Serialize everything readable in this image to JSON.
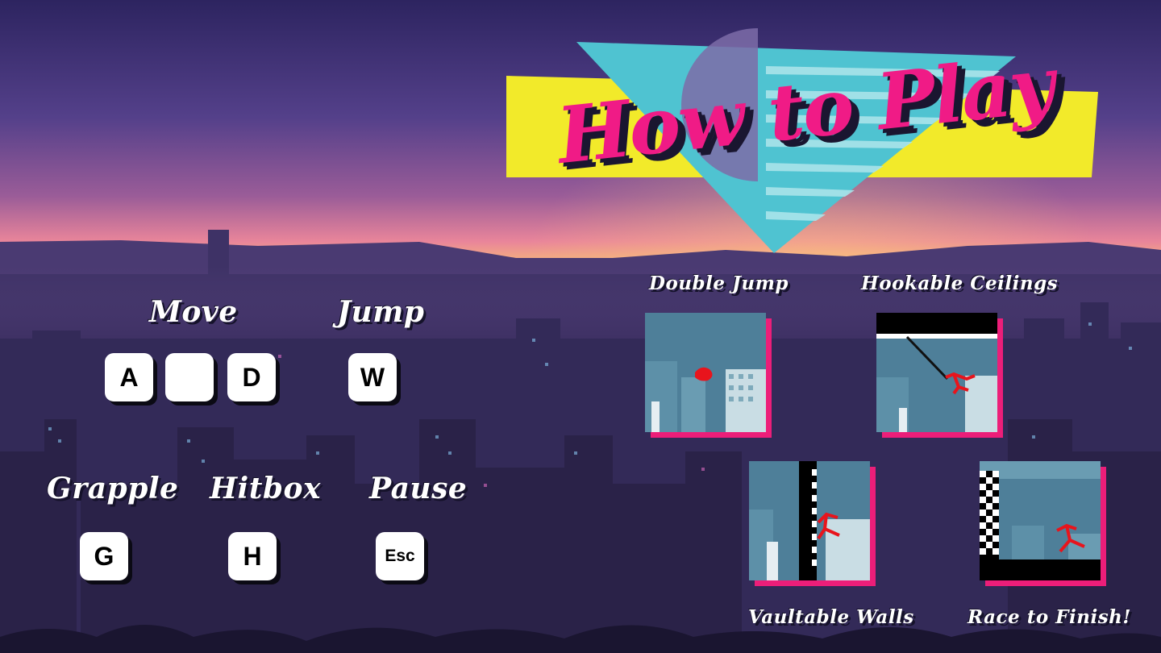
{
  "title": "How to Play",
  "controls": {
    "move": {
      "label": "Move",
      "keys": [
        "A",
        "",
        "D"
      ]
    },
    "jump": {
      "label": "Jump",
      "key": "W"
    },
    "grapple": {
      "label": "Grapple",
      "key": "G"
    },
    "hitbox": {
      "label": "Hitbox",
      "key": "H"
    },
    "pause": {
      "label": "Pause",
      "key": "Esc"
    }
  },
  "features": [
    {
      "label": "Double Jump"
    },
    {
      "label": "Hookable Ceilings"
    },
    {
      "label": "Vaultable Walls"
    },
    {
      "label": "Race to Finish!"
    }
  ],
  "colors": {
    "accent_pink": "#ec1e79",
    "title_pink": "#f01b86",
    "banner_yellow": "#f2ea2a",
    "triangle_cyan": "#4fc3d1",
    "stickman_red": "#e8141c"
  }
}
